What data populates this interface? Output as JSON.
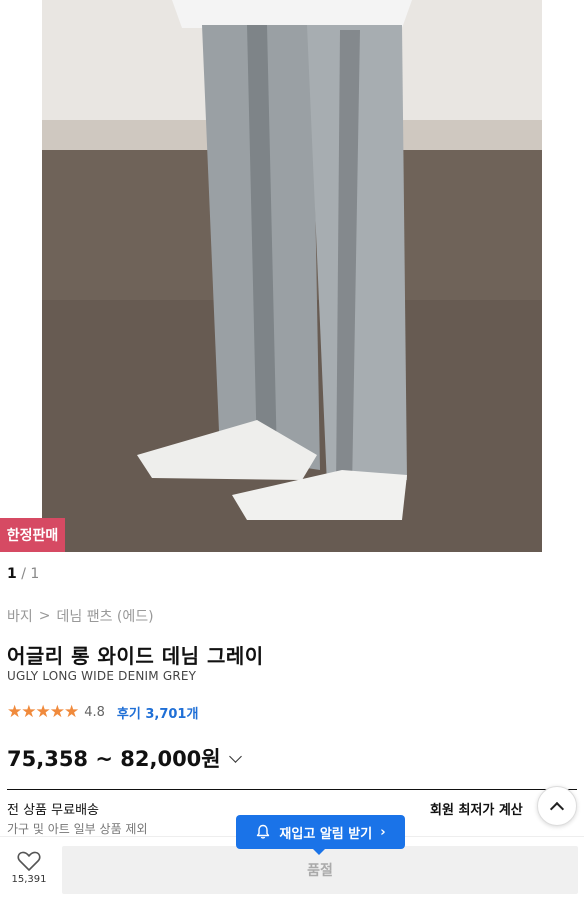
{
  "product": {
    "badge": "한정판매",
    "pager": {
      "current": "1",
      "sep": "/",
      "total": "1"
    },
    "breadcrumb": [
      "바지",
      ">",
      "데님 팬츠 (에드)"
    ],
    "title": "어글리 롱 와이드 데님 그레이",
    "subtitle": "UGLY LONG WIDE DENIM GREY",
    "stars": "★★★★★",
    "rating": "4.8",
    "reviews": "후기 3,701개",
    "price": "75,358 ~ 82,000원",
    "shipping_title": "전 상품 무료배송",
    "shipping_note": "가구 및 아트 일부 상품 제외",
    "member_price": "회원 최저가 계산"
  },
  "actions": {
    "restock_label": "재입고 알림 받기",
    "restock_chevron": "›",
    "wish_count": "15,391",
    "soldout_label": "품절"
  },
  "colors": {
    "badge": "#d64a63",
    "accent_blue": "#1a73e8",
    "star": "#f08a3c"
  },
  "icons": [
    "bell-icon",
    "heart-icon",
    "chevron-up-icon",
    "chevron-down-icon"
  ]
}
